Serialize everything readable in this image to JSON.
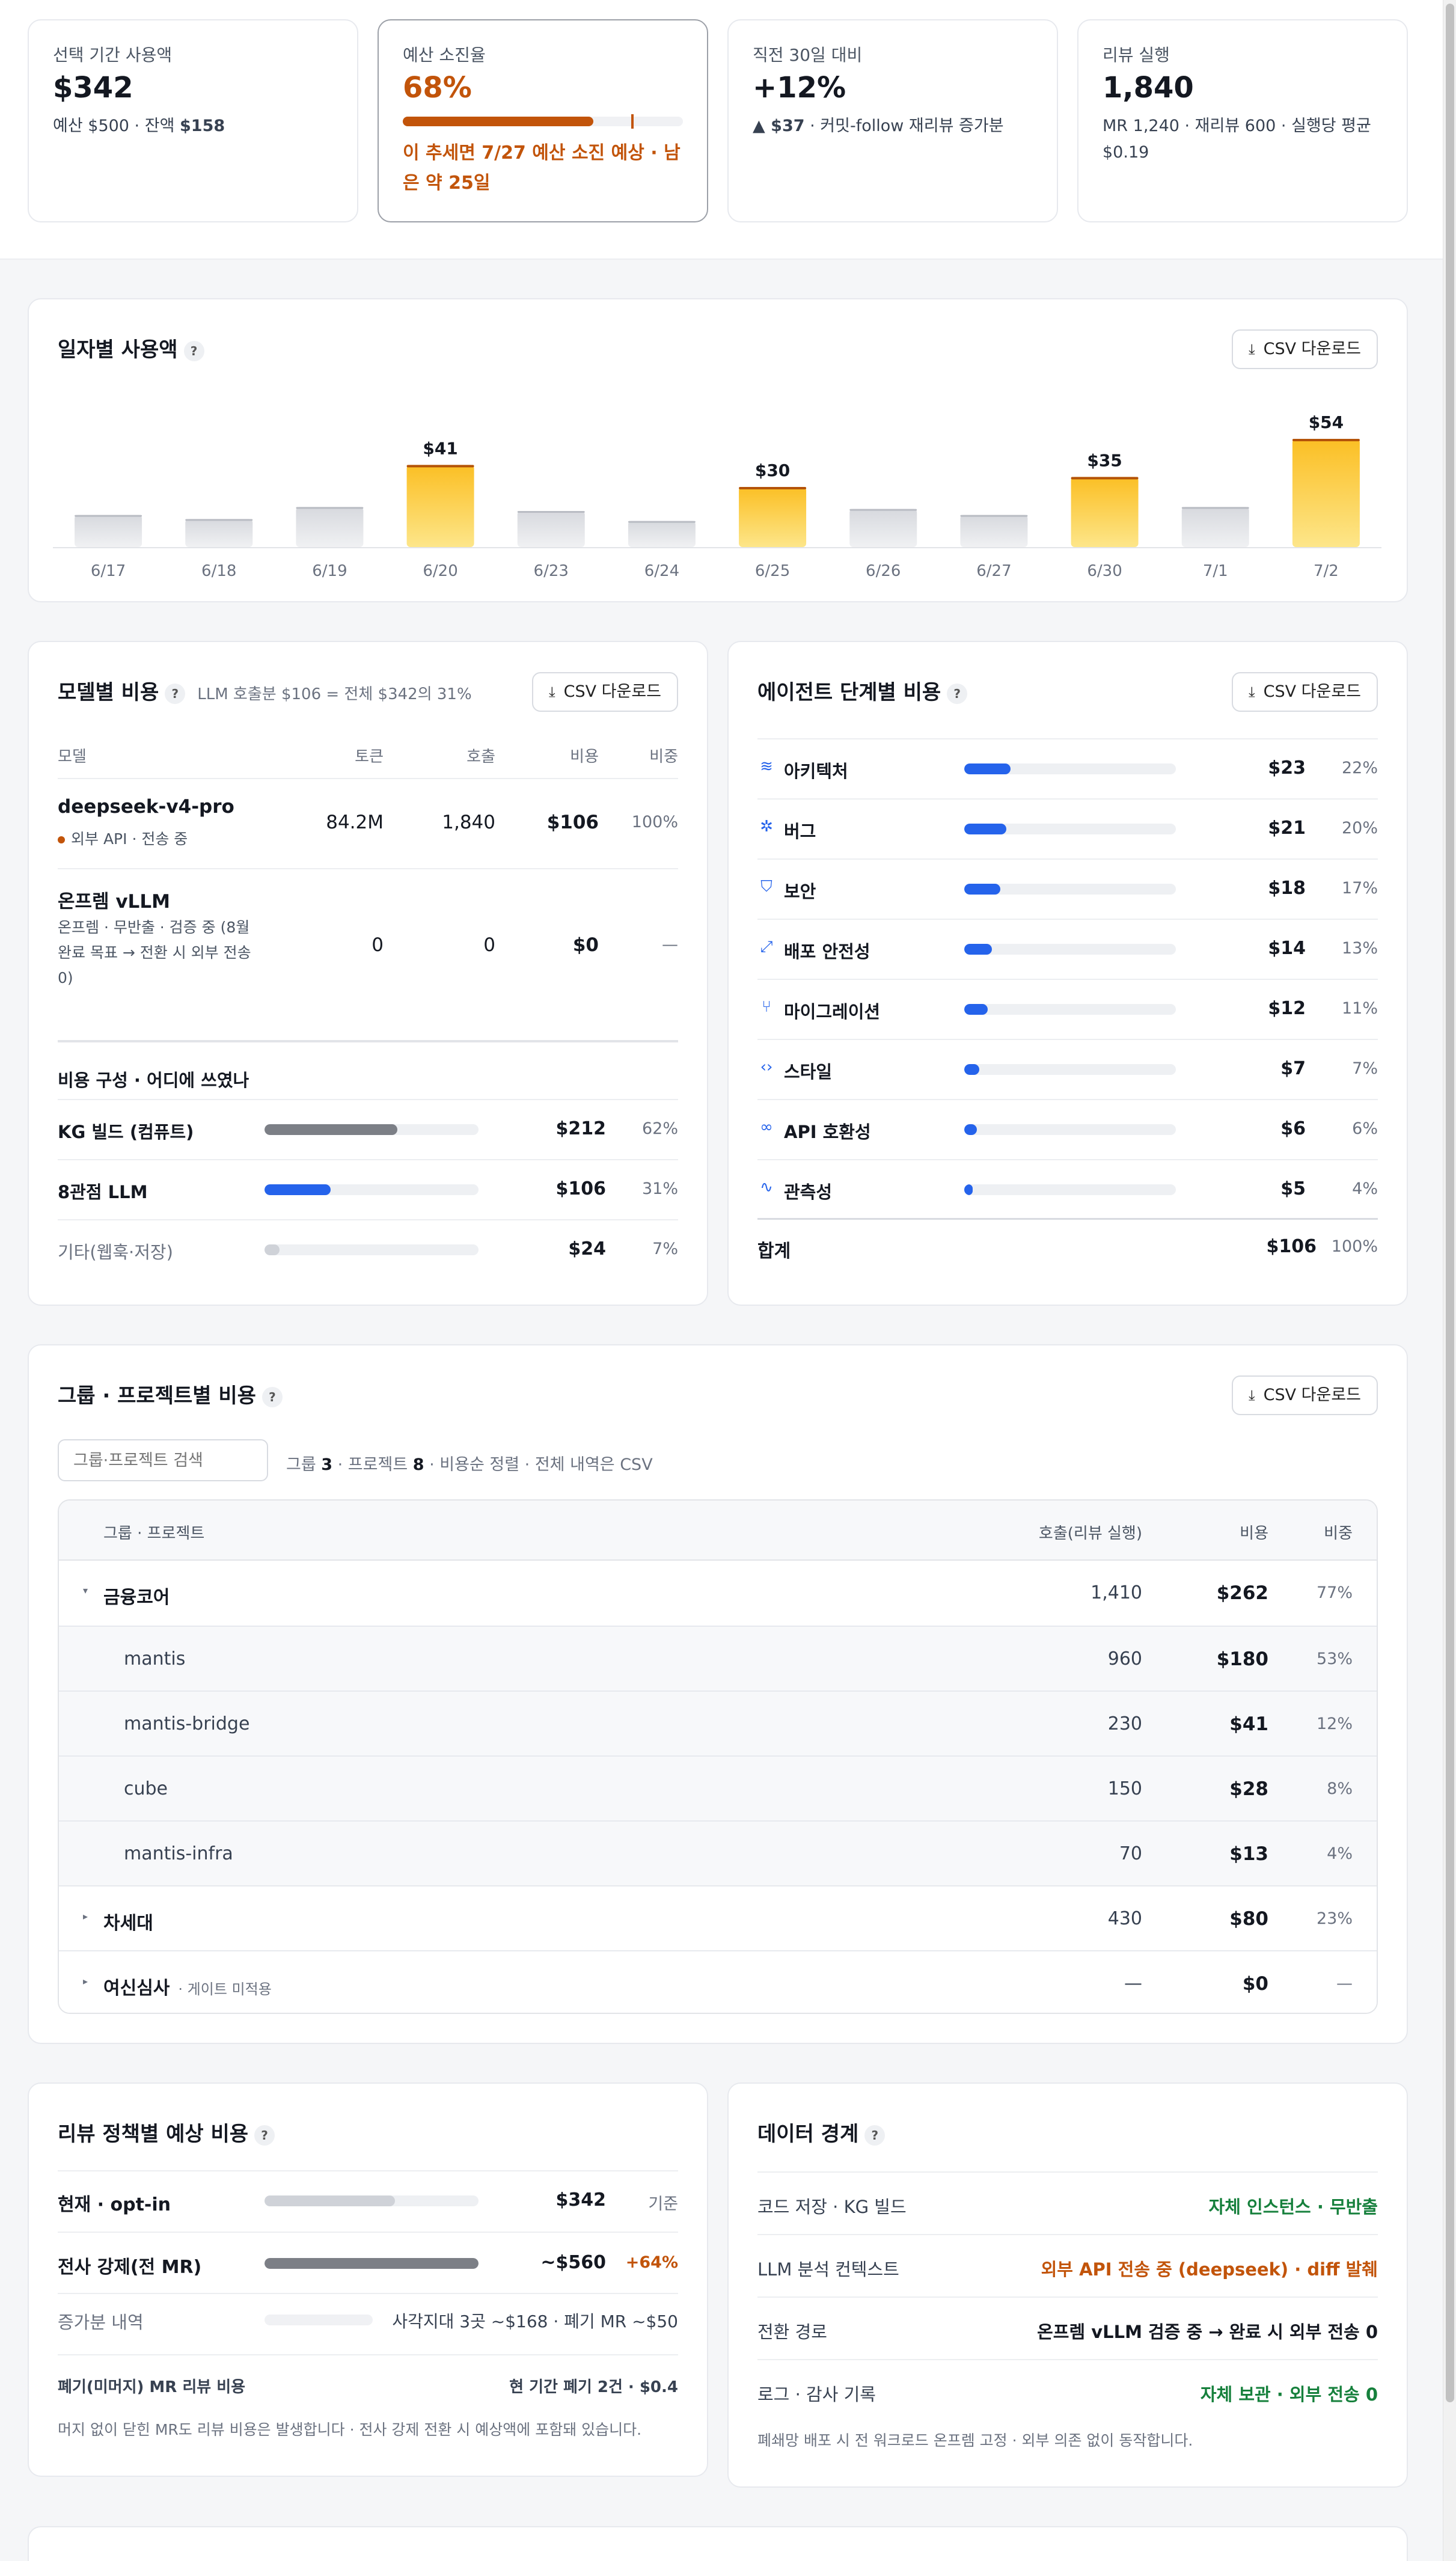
{
  "kpis": [
    {
      "label": "선택 기간 사용액",
      "value": "$342",
      "sub_a": "예산 $500 · 잔액 ",
      "sub_b": "$158"
    },
    {
      "label": "예산 소진율",
      "value": "68%",
      "progress": 0.68,
      "warn": "이 추세면 7/27 예산 소진 예상 · 남은 약 25일"
    },
    {
      "label": "직전 30일 대비",
      "value": "+12%",
      "sub_a": "▲ $37",
      "sub_b": " · 커밋-follow 재리뷰 증가분"
    },
    {
      "label": "리뷰 실행",
      "value": "1,840",
      "sub": "MR 1,240 · 재리뷰 600 · 실행당 평균 $0.19"
    }
  ],
  "daily": {
    "title": "일자별 사용액",
    "help": "?",
    "csv": "CSV 다운로드",
    "bars": [
      {
        "x": "6/17",
        "v": 16,
        "hi": false
      },
      {
        "x": "6/18",
        "v": 14,
        "hi": false
      },
      {
        "x": "6/19",
        "v": 20,
        "hi": false
      },
      {
        "x": "6/20",
        "v": 41,
        "hi": true,
        "label": "$41"
      },
      {
        "x": "6/23",
        "v": 18,
        "hi": false
      },
      {
        "x": "6/24",
        "v": 13,
        "hi": false
      },
      {
        "x": "6/25",
        "v": 30,
        "hi": true,
        "label": "$30"
      },
      {
        "x": "6/26",
        "v": 19,
        "hi": false
      },
      {
        "x": "6/27",
        "v": 16,
        "hi": false
      },
      {
        "x": "6/30",
        "v": 35,
        "hi": true,
        "label": "$35"
      },
      {
        "x": "7/1",
        "v": 20,
        "hi": false
      },
      {
        "x": "7/2",
        "v": 54,
        "hi": true,
        "label": "$54"
      }
    ]
  },
  "model_cost": {
    "title": "모델별 비용",
    "note": "LLM 호출분 $106 = 전체 $342의 31%",
    "csv": "CSV 다운로드",
    "headers": {
      "model": "모델",
      "tokens": "토큰",
      "calls": "호출",
      "cost": "비용",
      "share": "비중"
    },
    "rows": [
      {
        "name": "deepseek-v4-pro",
        "desc": "외부 API · 전송 중",
        "tokens": "84.2M",
        "calls": "1,840",
        "cost": "$106",
        "share": "100%"
      },
      {
        "name": "온프렘 vLLM",
        "desc": "온프렘 · 무반출 · 검증 중 (8월 완료 목표 → 전환 시 외부 전송 0)",
        "tokens": "0",
        "calls": "0",
        "cost": "$0",
        "share": "—"
      }
    ],
    "breakdown_title": "비용 구성 · 어디에 쓰였나",
    "breakdown": [
      {
        "label": "KG 빌드 (컴퓨트)",
        "frac": 0.62,
        "cost": "$212",
        "share": "62%",
        "color": "#7c7f86"
      },
      {
        "label": "8관점 LLM",
        "frac": 0.31,
        "cost": "$106",
        "share": "31%",
        "color": "#2563eb"
      },
      {
        "label": "기타(웹훅·저장)",
        "frac": 0.07,
        "cost": "$24",
        "share": "7%",
        "color": "#cfd2d8"
      }
    ]
  },
  "agent_cost": {
    "title": "에이전트 단계별 비용",
    "csv": "CSV 다운로드",
    "rows": [
      {
        "icon": "layers-icon",
        "glyph": "≋",
        "label": "아키텍처",
        "frac": 0.22,
        "cost": "$23",
        "share": "22%"
      },
      {
        "icon": "bug-icon",
        "glyph": "✲",
        "label": "버그",
        "frac": 0.2,
        "cost": "$21",
        "share": "20%"
      },
      {
        "icon": "shield-icon",
        "glyph": "⛉",
        "label": "보안",
        "frac": 0.17,
        "cost": "$18",
        "share": "17%"
      },
      {
        "icon": "deploy-icon",
        "glyph": "⤢",
        "label": "배포 안전성",
        "frac": 0.13,
        "cost": "$14",
        "share": "13%"
      },
      {
        "icon": "branch-icon",
        "glyph": "⑂",
        "label": "마이그레이션",
        "frac": 0.11,
        "cost": "$12",
        "share": "11%"
      },
      {
        "icon": "code-icon",
        "glyph": "‹›",
        "label": "스타일",
        "frac": 0.07,
        "cost": "$7",
        "share": "7%"
      },
      {
        "icon": "link-icon",
        "glyph": "∞",
        "label": "API 호환성",
        "frac": 0.06,
        "cost": "$6",
        "share": "6%"
      },
      {
        "icon": "pulse-icon",
        "glyph": "∿",
        "label": "관측성",
        "frac": 0.04,
        "cost": "$5",
        "share": "4%"
      }
    ],
    "total_label": "합계",
    "total_cost": "$106",
    "total_share": "100%"
  },
  "groups": {
    "title": "그룹 · 프로젝트별 비용",
    "csv": "CSV 다운로드",
    "search_placeholder": "그룹·프로젝트 검색",
    "summary_a": "그룹 ",
    "summary_n1": "3",
    "summary_b": " · 프로젝트 ",
    "summary_n2": "8",
    "summary_c": " · 비용순 정렬 · 전체 내역은 CSV",
    "headers": {
      "name": "그룹 · 프로젝트",
      "calls": "호출(리뷰 실행)",
      "cost": "비용",
      "share": "비중"
    },
    "rows": [
      {
        "type": "group",
        "open": true,
        "name": "금융코어",
        "note": "",
        "calls": "1,410",
        "cost": "$262",
        "share": "77%"
      },
      {
        "type": "project",
        "name": "mantis",
        "calls": "960",
        "cost": "$180",
        "share": "53%"
      },
      {
        "type": "project",
        "name": "mantis-bridge",
        "calls": "230",
        "cost": "$41",
        "share": "12%"
      },
      {
        "type": "project",
        "name": "cube",
        "calls": "150",
        "cost": "$28",
        "share": "8%"
      },
      {
        "type": "project",
        "name": "mantis-infra",
        "calls": "70",
        "cost": "$13",
        "share": "4%"
      },
      {
        "type": "group",
        "open": false,
        "name": "차세대",
        "note": "",
        "calls": "430",
        "cost": "$80",
        "share": "23%"
      },
      {
        "type": "group",
        "open": false,
        "name": "여신심사",
        "note": "· 게이트 미적용",
        "calls": "—",
        "cost": "$0",
        "share": "—"
      }
    ]
  },
  "policy": {
    "title": "리뷰 정책별 예상 비용",
    "rows": [
      {
        "label": "현재 · opt-in",
        "frac": 0.61,
        "cost": "$342",
        "tail": "기준",
        "bold": true
      },
      {
        "label": "전사 강제(전 MR)",
        "frac": 1.0,
        "cost": "~$560",
        "tail": "+64%",
        "bold": true
      }
    ],
    "increase_label": "증가분 내역",
    "increase_text": "사각지대 3곳 ~$168 · 폐기 MR ~$50",
    "discard_label": "폐기(미머지) MR 리뷰 비용",
    "discard_value": "현 기간 폐기 2건 · $0.4",
    "footnote": "머지 없이 닫힌 MR도 리뷰 비용은 발생합니다 · 전사 강제 전환 시 예상액에 포함돼 있습니다."
  },
  "boundary": {
    "title": "데이터 경계",
    "rows": [
      {
        "label": "코드 저장 · KG 빌드",
        "value": "자체 인스턴스 · 무반출",
        "tone": "green"
      },
      {
        "label": "LLM 분석 컨텍스트",
        "value": "외부 API 전송 중 (deepseek) · diff 발췌",
        "tone": "orange"
      },
      {
        "label": "전환 경로",
        "value": "온프렘 vLLM 검증 중 → 완료 시 외부 전송 0",
        "tone": "dark"
      },
      {
        "label": "로그 · 감사 기록",
        "value": "자체 보관 · 외부 전송 0",
        "tone": "green"
      }
    ],
    "footnote": "폐쇄망 배포 시 전 워크로드 온프렘 고정 · 외부 의존 없이 동작합니다."
  },
  "colors": {
    "accent": "#2563eb",
    "warn": "#c2540a",
    "bar_hi": "#fcd535",
    "bar_hi_top": "#b45309",
    "bar_lo": "#d9dbe0",
    "green": "#16803c"
  }
}
